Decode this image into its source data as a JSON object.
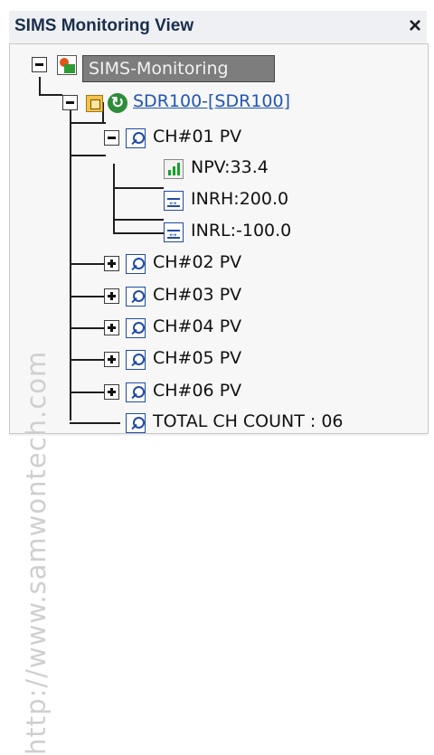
{
  "window": {
    "title": "SIMS Monitoring View",
    "close_glyph": "×"
  },
  "watermark": "http://www.samwontech.com",
  "tree": {
    "root": {
      "label": "SIMS-Monitoring",
      "icon": "monitor-icon",
      "expanded": true
    },
    "device": {
      "label": "SDR100-[SDR100]",
      "icons": [
        "device-icon",
        "refresh-icon"
      ],
      "expanded": true
    },
    "channels": [
      {
        "label": "CH#01 PV",
        "expanded": true,
        "children": [
          {
            "label": "NPV:33.4",
            "icon": "bar-chart-icon"
          },
          {
            "label": "INRH:200.0",
            "icon": "range-icon"
          },
          {
            "label": "INRL:-100.0",
            "icon": "range-icon"
          }
        ]
      },
      {
        "label": "CH#02 PV",
        "expanded": false
      },
      {
        "label": "CH#03 PV",
        "expanded": false
      },
      {
        "label": "CH#04 PV",
        "expanded": false
      },
      {
        "label": "CH#05 PV",
        "expanded": false
      },
      {
        "label": "CH#06 PV",
        "expanded": false
      }
    ],
    "total": {
      "label": "TOTAL CH COUNT : 06",
      "icon": "search-icon"
    }
  }
}
